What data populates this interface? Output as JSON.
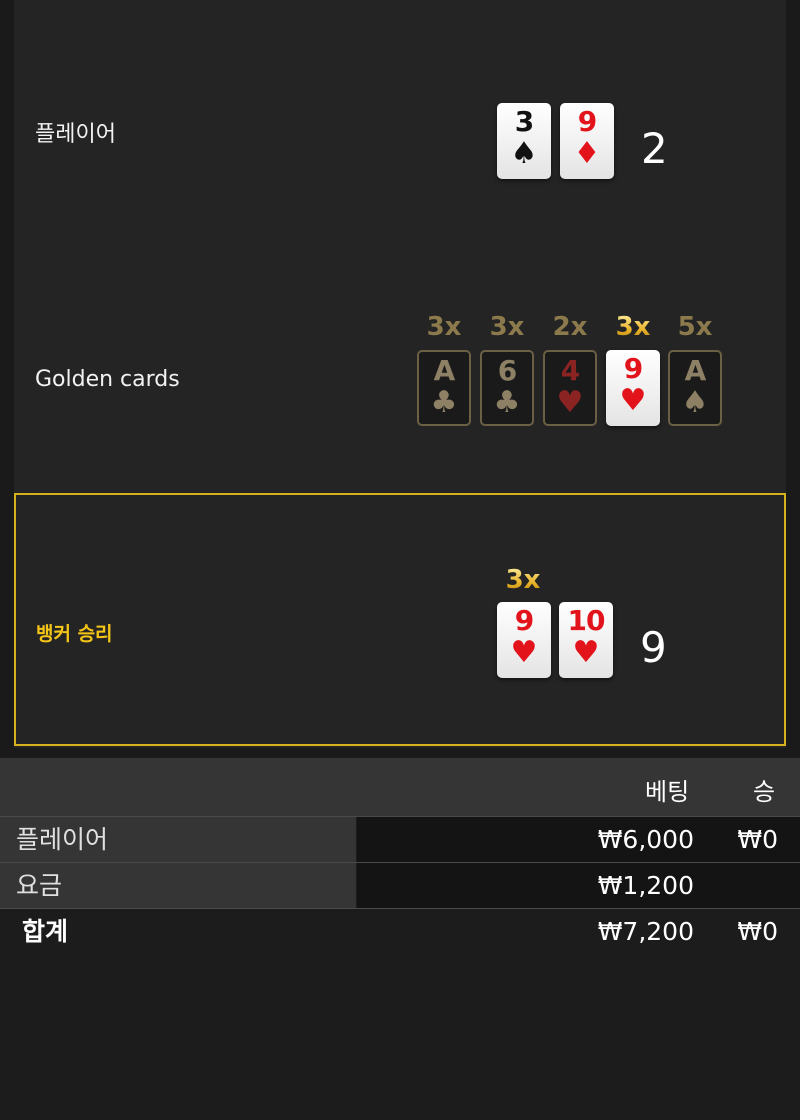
{
  "player": {
    "label": "플레이어",
    "cards": [
      {
        "rank": "3",
        "suit": "♠",
        "color": "black"
      },
      {
        "rank": "9",
        "suit": "♦",
        "color": "red"
      }
    ],
    "score": "2"
  },
  "golden": {
    "label": "Golden cards",
    "cards": [
      {
        "mult": "3x",
        "rank": "A",
        "suit": "♣",
        "active": false
      },
      {
        "mult": "3x",
        "rank": "6",
        "suit": "♣",
        "active": false
      },
      {
        "mult": "2x",
        "rank": "4",
        "suit": "♥",
        "active": false
      },
      {
        "mult": "3x",
        "rank": "9",
        "suit": "♥",
        "active": true
      },
      {
        "mult": "5x",
        "rank": "A",
        "suit": "♠",
        "active": false
      }
    ]
  },
  "banker": {
    "label": "뱅커 승리",
    "multiplier": "3x",
    "cards": [
      {
        "rank": "9",
        "suit": "♥",
        "color": "red"
      },
      {
        "rank": "10",
        "suit": "♥",
        "color": "red"
      }
    ],
    "score": "9",
    "highlight_color": "#d7b21d"
  },
  "table": {
    "headers": {
      "bet": "베팅",
      "win": "승"
    },
    "rows": [
      {
        "label": "플레이어",
        "bet": "₩6,000",
        "win": "₩0"
      },
      {
        "label": "요금",
        "bet": "₩1,200",
        "win": ""
      }
    ],
    "total": {
      "label": "합계",
      "bet": "₩7,200",
      "win": "₩0"
    }
  }
}
